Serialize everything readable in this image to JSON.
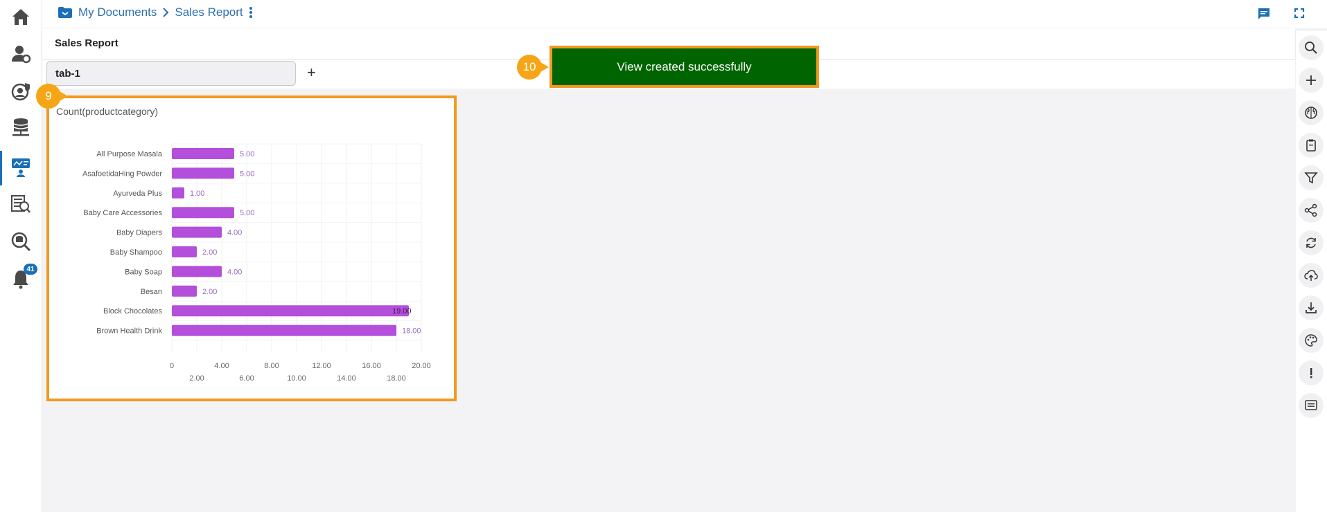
{
  "breadcrumb": {
    "root": "My Documents",
    "current": "Sales Report"
  },
  "title": "Sales Report",
  "tabs": [
    {
      "label": "tab-1"
    }
  ],
  "tab_add_label": "+",
  "widget": {
    "title": "Count(productcategory)"
  },
  "toast": {
    "message": "View created successfully"
  },
  "markers": {
    "widget": "9",
    "toast": "10"
  },
  "notifications": {
    "count": "41"
  },
  "left_nav": [
    "home-icon",
    "user-settings-icon",
    "shield-user-icon",
    "database-icon",
    "dashboard-designer-icon",
    "data-catalog-icon",
    "data-search-icon",
    "notification-bell-icon"
  ],
  "right_toolbar": [
    "search-icon",
    "add-icon",
    "brain-icon",
    "clipboard-icon",
    "filter-icon",
    "share-icon",
    "refresh-icon",
    "cloud-upload-icon",
    "download-icon",
    "palette-icon",
    "info-icon",
    "comment-icon"
  ],
  "colors": {
    "accent": "#1a6fb7",
    "bar": "#b34fdb",
    "highlight": "#f29a1f",
    "toast": "#006400",
    "marker": "#f5a515"
  },
  "chart_data": {
    "type": "bar",
    "orientation": "horizontal",
    "categories": [
      "All Purpose Masala",
      "AsafoetidaHing Powder",
      "Ayurveda Plus",
      "Baby Care Accessories",
      "Baby Diapers",
      "Baby Shampoo",
      "Baby Soap",
      "Besan",
      "Block Chocolates",
      "Brown Health Drink"
    ],
    "values": [
      5,
      5,
      1,
      5,
      4,
      2,
      4,
      2,
      19,
      18
    ],
    "value_labels": [
      "5.00",
      "5.00",
      "1.00",
      "5.00",
      "4.00",
      "2.00",
      "4.00",
      "2.00",
      "19.00",
      "18.00"
    ],
    "x_ticks_upper": [
      "0",
      "4.00",
      "8.00",
      "12.00",
      "16.00",
      "20.00"
    ],
    "x_ticks_lower": [
      "2.00",
      "6.00",
      "10.00",
      "14.00",
      "18.00"
    ],
    "xlim": [
      0,
      20
    ],
    "title": "Count(productcategory)",
    "grid": true
  }
}
